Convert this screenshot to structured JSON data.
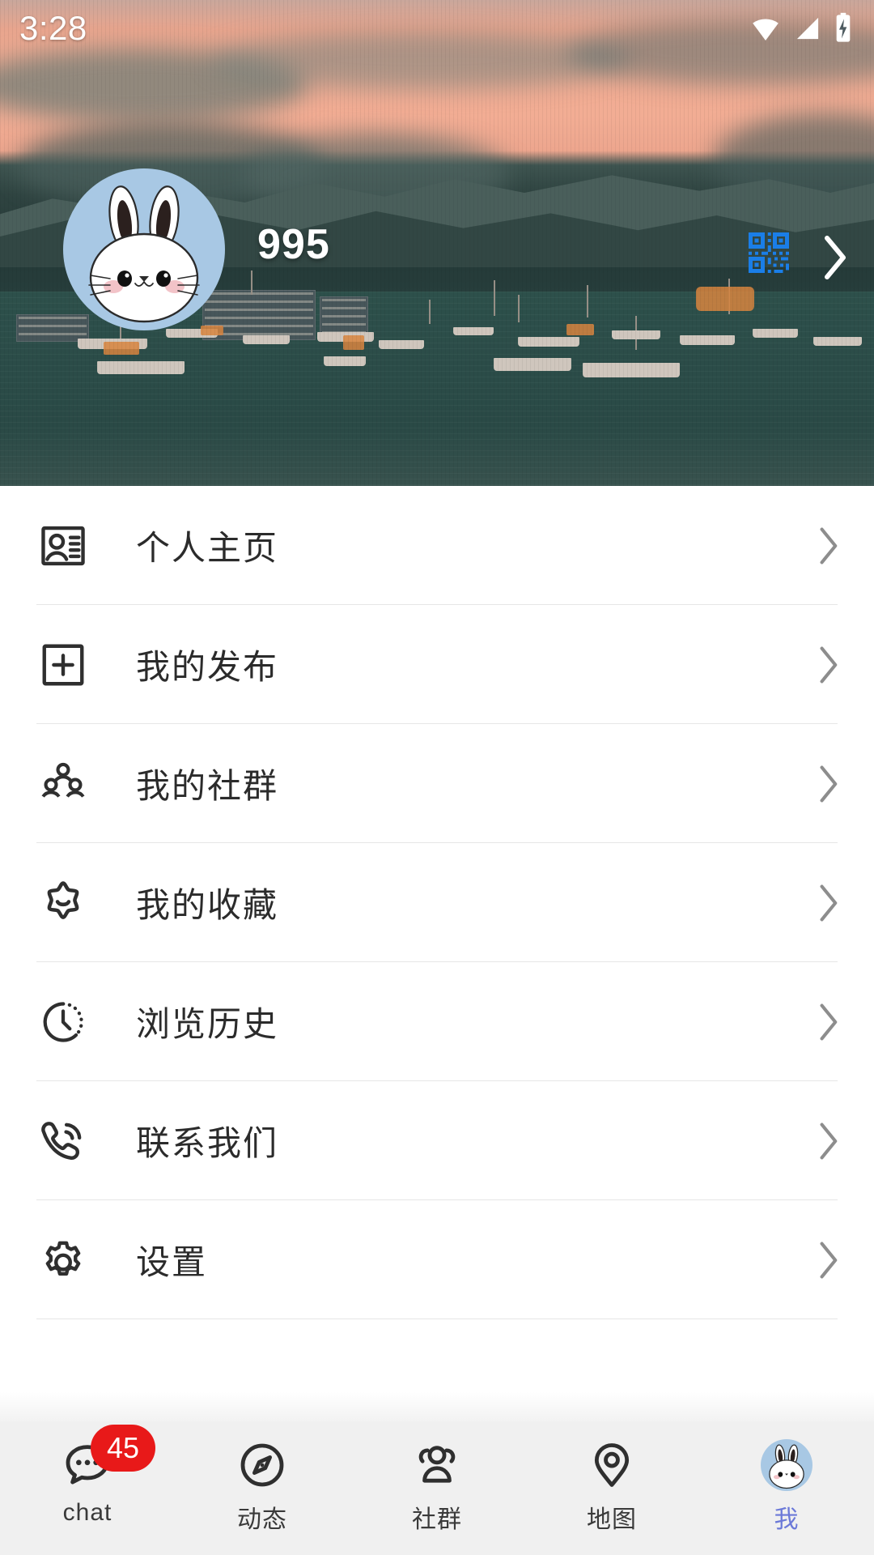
{
  "status_bar": {
    "time": "3:28",
    "icons": [
      "wifi-icon",
      "cell-signal-icon",
      "battery-charging-icon"
    ]
  },
  "header": {
    "background": "harbor-sunset-photo",
    "avatar_icon": "rabbit-avatar",
    "avatar_bg_color": "#a8c8e4",
    "username": "995",
    "qr_icon": "qr-code-icon",
    "qr_color": "#1a7ee8",
    "chevron_icon": "chevron-right-icon"
  },
  "menu": {
    "items": [
      {
        "label": "个人主页",
        "icon": "contact-card-icon",
        "chevron": "chevron-right-icon"
      },
      {
        "label": "我的发布",
        "icon": "plus-square-icon",
        "chevron": "chevron-right-icon"
      },
      {
        "label": "我的社群",
        "icon": "group-people-icon",
        "chevron": "chevron-right-icon"
      },
      {
        "label": "我的收藏",
        "icon": "star-smile-icon",
        "chevron": "chevron-right-icon"
      },
      {
        "label": "浏览历史",
        "icon": "history-clock-icon",
        "chevron": "chevron-right-icon"
      },
      {
        "label": "联系我们",
        "icon": "phone-call-icon",
        "chevron": "chevron-right-icon"
      },
      {
        "label": "设置",
        "icon": "gear-icon",
        "chevron": "chevron-right-icon"
      }
    ]
  },
  "bottom_nav": {
    "active_color": "#6b79d8",
    "badge_color": "#e81919",
    "items": [
      {
        "label": "chat",
        "icon": "chat-bubble-icon",
        "badge": "45",
        "active": false
      },
      {
        "label": "动态",
        "icon": "compass-icon",
        "badge": "",
        "active": false
      },
      {
        "label": "社群",
        "icon": "people-group-icon",
        "badge": "",
        "active": false
      },
      {
        "label": "地图",
        "icon": "map-pin-icon",
        "badge": "",
        "active": false
      },
      {
        "label": "我",
        "icon": "rabbit-avatar-icon",
        "badge": "",
        "active": true
      }
    ]
  }
}
